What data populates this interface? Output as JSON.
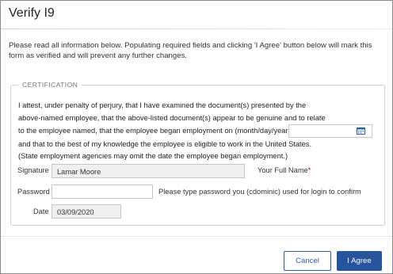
{
  "dialog": {
    "title": "Verify I9",
    "intro": "Please read all information below. Populating required fields and clicking 'I Agree' button below will mark this form as verified and will prevent any further changes."
  },
  "certification": {
    "legend": "CERTIFICATION",
    "line1": "I attest, under penalty of perjury, that I have examined the document(s) presented by the",
    "line2": "above-named employee, that the above-listed document(s) appear to be genuine and to relate",
    "line3": "to the employee named, that the employee began employment on (month/day/year)",
    "required_mark": "*",
    "line4": "and that to the best of my knowledge the employee is eligible to work in the United States.",
    "line5": "(State employment agencies may omit the date the employee began employment.)",
    "start_date_value": ""
  },
  "form": {
    "signature_label": "Signature",
    "signature_value": "Lamar Moore",
    "full_name_label": "Your Full Name",
    "full_name_required": "*",
    "password_label": "Password",
    "password_value": "",
    "password_hint": "Please type password you (cdominic) used for login to confirm",
    "date_label": "Date",
    "date_value": "03/09/2020"
  },
  "buttons": {
    "cancel": "Cancel",
    "agree": "I Agree"
  },
  "icons": {
    "calendar": "calendar-icon"
  },
  "colors": {
    "primary": "#27549c",
    "required": "#d0021b"
  }
}
